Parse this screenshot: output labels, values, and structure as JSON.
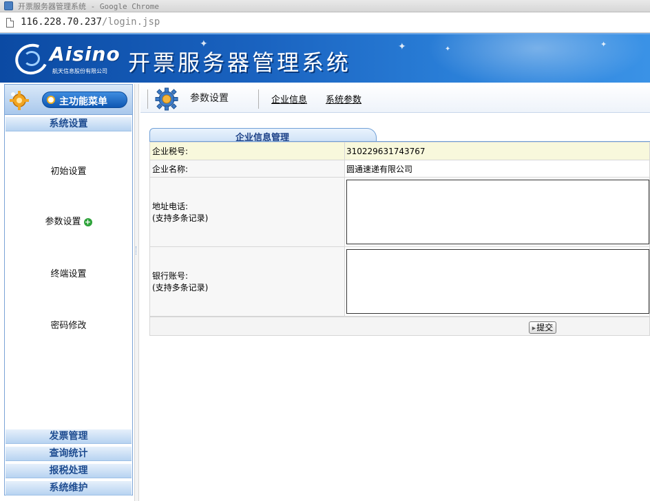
{
  "browser": {
    "window_title": "开票服务器管理系统 - Google Chrome",
    "url_host": "116.228.70.237",
    "url_path": "/login.jsp"
  },
  "header": {
    "logo_text": "Aisino",
    "logo_subtext": "航天信息股份有限公司",
    "system_title": "开票服务器管理系统"
  },
  "sidebar": {
    "menu_title": "主功能菜单",
    "active_section": "系统设置",
    "items": [
      {
        "label": "初始设置"
      },
      {
        "label": "参数设置"
      },
      {
        "label": "终端设置"
      },
      {
        "label": "密码修改"
      }
    ],
    "bottom_sections": [
      "发票管理",
      "查询统计",
      "报税处理",
      "系统维护"
    ]
  },
  "toolbar": {
    "current": "参数设置",
    "links": [
      "企业信息",
      "系统参数"
    ]
  },
  "form": {
    "tab_title": "企业信息管理",
    "tax_id_label": "企业税号:",
    "tax_id_value": "310229631743767",
    "name_label": "企业名称:",
    "name_value": "圆通速递有限公司",
    "address_label": "地址电话:",
    "address_note": "(支持多条记录)",
    "address_value": "",
    "bank_label": "银行账号:",
    "bank_note": "(支持多条记录)",
    "bank_value": "",
    "submit_label": "提交"
  },
  "colors": {
    "banner": "#1a63c0",
    "section_text": "#1f4d91",
    "highlight_row": "#f8f8dc"
  }
}
